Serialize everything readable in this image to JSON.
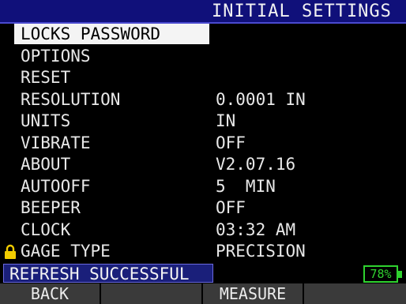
{
  "title": "INITIAL SETTINGS",
  "menu": {
    "items": [
      {
        "label": "LOCKS PASSWORD",
        "value": ""
      },
      {
        "label": "OPTIONS",
        "value": ""
      },
      {
        "label": "RESET",
        "value": ""
      },
      {
        "label": "RESOLUTION",
        "value": "0.0001 IN"
      },
      {
        "label": "UNITS",
        "value": "IN"
      },
      {
        "label": "VIBRATE",
        "value": "OFF"
      },
      {
        "label": "ABOUT",
        "value": "V2.07.16"
      },
      {
        "label": "AUTOOFF",
        "value": "5  MIN"
      },
      {
        "label": "BEEPER",
        "value": "OFF"
      },
      {
        "label": "CLOCK",
        "value": "03:32 AM"
      },
      {
        "label": "GAGE TYPE",
        "value": "PRECISION"
      }
    ]
  },
  "status": {
    "message": "REFRESH SUCCESSFUL",
    "battery": "78%"
  },
  "softkeys": [
    "BACK",
    "",
    "MEASURE",
    ""
  ],
  "colors": {
    "title_bar": "#10107a",
    "selection": "#f4f4f4",
    "status_bar": "#1a1f7a",
    "battery": "#2fd22f",
    "lock_icon": "#f2cc00",
    "softkey_bar": "#3a3a3a"
  },
  "icons": {
    "gage_type_lock": "lock-icon"
  }
}
